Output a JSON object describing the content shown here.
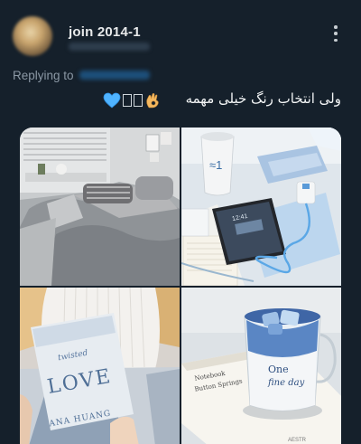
{
  "author": {
    "display_name": "join 2014-1",
    "avatar_icon": "blurred-avatar"
  },
  "header": {
    "more_icon": "vertical-ellipsis-icon"
  },
  "reply": {
    "prefix": "Replying to"
  },
  "tweet": {
    "text": "ولی انتخاب رنگ خیلی مهمه",
    "emojis": [
      "ok-hand-icon",
      "missing-glyph-box",
      "missing-glyph-box",
      "blue-heart-icon"
    ]
  },
  "media": {
    "images": [
      {
        "name": "bedroom-photo",
        "alt": "grey bedroom with bed and window"
      },
      {
        "name": "desk-photo",
        "alt": "desk with cup, phone, charger"
      },
      {
        "name": "book-photo",
        "alt": "person holding book"
      },
      {
        "name": "drink-photo",
        "alt": "glass of blue drink on book"
      }
    ],
    "book_title_top": "twisted",
    "book_title_main": "LOVE",
    "book_author": "ANA HUANG",
    "cup_brand": "≈1",
    "phone_time": "12:41",
    "mug_text_top": "One",
    "mug_text_script": "fine day",
    "notebook_text_1": "Notebook",
    "notebook_text_2": "Button Springs",
    "notebook_footer": "AESTR"
  },
  "colors": {
    "background": "#15202b",
    "text_primary": "#e7e9ea",
    "text_secondary": "#8b98a5",
    "accent_blue": "#1d9bf0"
  }
}
